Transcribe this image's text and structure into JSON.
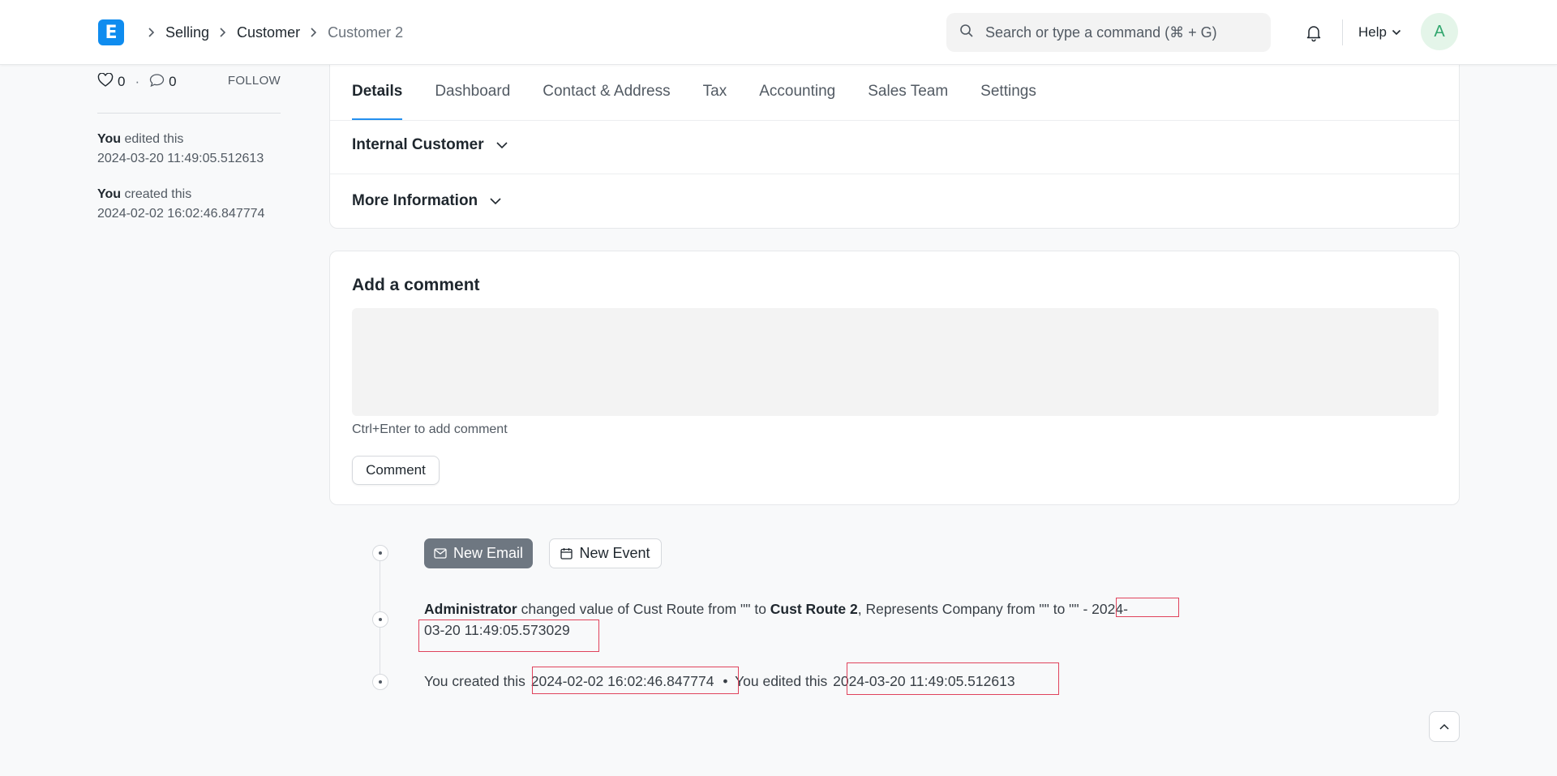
{
  "navbar": {
    "logo_letter": "E",
    "breadcrumbs": [
      "Selling",
      "Customer",
      "Customer 2"
    ],
    "search_placeholder": "Search or type a command (⌘ + G)",
    "help_label": "Help",
    "avatar_letter": "A"
  },
  "sidebar": {
    "likes": "0",
    "comments": "0",
    "follow_label": "FOLLOW",
    "activity": [
      {
        "who": "You",
        "action": "edited this",
        "time": "2024-03-20 11:49:05.512613"
      },
      {
        "who": "You",
        "action": "created this",
        "time": "2024-02-02 16:02:46.847774"
      }
    ]
  },
  "form": {
    "tabs": [
      "Details",
      "Dashboard",
      "Contact & Address",
      "Tax",
      "Accounting",
      "Sales Team",
      "Settings"
    ],
    "active_tab": "Details",
    "sections": [
      "Internal Customer",
      "More Information"
    ]
  },
  "comment": {
    "title": "Add a comment",
    "hint": "Ctrl+Enter to add comment",
    "button": "Comment"
  },
  "timeline": {
    "new_email": "New Email",
    "new_event": "New Event",
    "change": {
      "actor": "Administrator",
      "text1": "changed value of Cust Route from \"\" to",
      "value": "Cust Route 2",
      "text2": ", Represents Company from \"\" to \"\" -",
      "time_part1": "2024-",
      "time_part2": "03-20 11:49:05.573029"
    },
    "created_label": "You created this",
    "created_time": "2024-02-02 16:02:46.847774",
    "separator": "•",
    "edited_label": "You edited this",
    "edited_time": "2024-03-20 11:49:05.512613"
  },
  "colors": {
    "accent": "#2490ef",
    "logo": "#0f8cef",
    "highlight_box": "#e0435c",
    "email_button": "#6e7781"
  }
}
